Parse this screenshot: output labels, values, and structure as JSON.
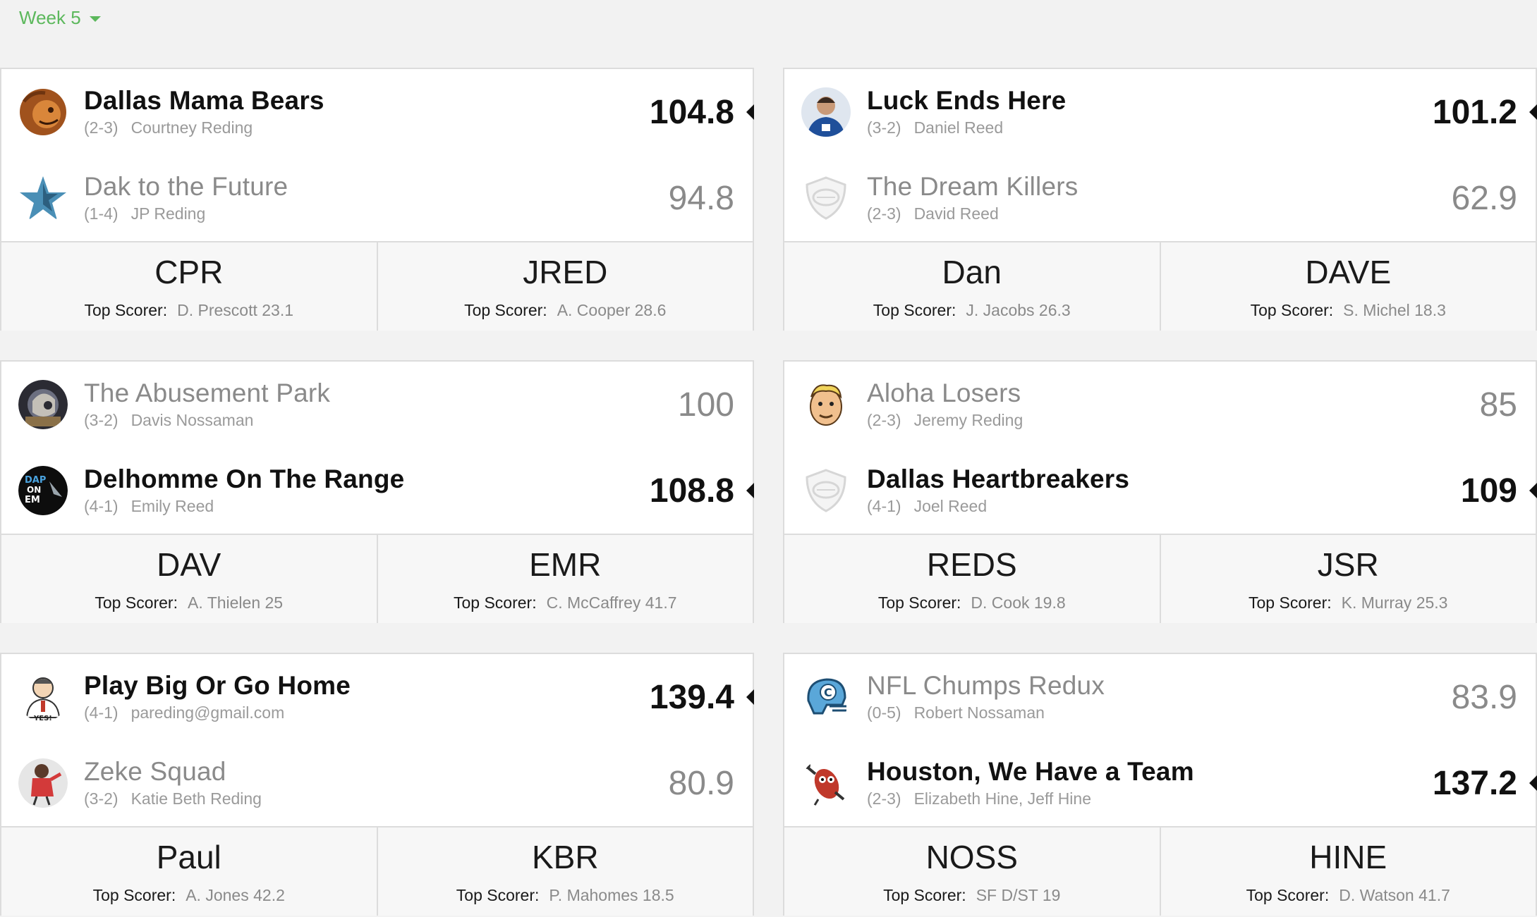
{
  "week_selector": {
    "label": "Week 5"
  },
  "labels": {
    "top_scorer": "Top Scorer:"
  },
  "colors": {
    "accent": "#5cb85c",
    "winner_text": "#111111",
    "loser_text": "#8a8a8a",
    "card_bg": "#ffffff",
    "page_bg": "#f2f2f2"
  },
  "matchups": [
    {
      "home": {
        "name": "Dallas Mama Bears",
        "record": "(2-3)",
        "owner": "Courtney Reding",
        "score": "104.8",
        "icon": "lion-logo-icon",
        "winner": true
      },
      "away": {
        "name": "Dak to the Future",
        "record": "(1-4)",
        "owner": "JP Reding",
        "score": "94.8",
        "icon": "star-logo-icon",
        "winner": false
      },
      "footer": [
        {
          "abbr": "CPR",
          "top_scorer": "D. Prescott 23.1"
        },
        {
          "abbr": "JRED",
          "top_scorer": "A. Cooper 28.6"
        }
      ]
    },
    {
      "home": {
        "name": "Luck Ends Here",
        "record": "(3-2)",
        "owner": "Daniel Reed",
        "score": "101.2",
        "icon": "player-photo-icon",
        "winner": true
      },
      "away": {
        "name": "The Dream Killers",
        "record": "(2-3)",
        "owner": "David Reed",
        "score": "62.9",
        "icon": "default-shield-icon",
        "winner": false
      },
      "footer": [
        {
          "abbr": "Dan",
          "top_scorer": "J. Jacobs 26.3"
        },
        {
          "abbr": "DAVE",
          "top_scorer": "S. Michel 18.3"
        }
      ]
    },
    {
      "home": {
        "name": "The Abusement Park",
        "record": "(3-2)",
        "owner": "Davis Nossaman",
        "score": "100",
        "icon": "photo-avatar-icon",
        "winner": false
      },
      "away": {
        "name": "Delhomme On The Range",
        "record": "(4-1)",
        "owner": "Emily Reed",
        "score": "108.8",
        "icon": "text-logo-icon",
        "winner": true
      },
      "footer": [
        {
          "abbr": "DAV",
          "top_scorer": "A. Thielen 25"
        },
        {
          "abbr": "EMR",
          "top_scorer": "C. McCaffrey 41.7"
        }
      ]
    },
    {
      "home": {
        "name": "Aloha Losers",
        "record": "(2-3)",
        "owner": "Jeremy Reding",
        "score": "85",
        "icon": "cartoon-face-icon",
        "winner": false
      },
      "away": {
        "name": "Dallas Heartbreakers",
        "record": "(4-1)",
        "owner": "Joel Reed",
        "score": "109",
        "icon": "default-shield-icon",
        "winner": true
      },
      "footer": [
        {
          "abbr": "REDS",
          "top_scorer": "D. Cook 19.8"
        },
        {
          "abbr": "JSR",
          "top_scorer": "K. Murray 25.3"
        }
      ]
    },
    {
      "home": {
        "name": "Play Big Or Go Home",
        "record": "(4-1)",
        "owner": "pareding@gmail.com",
        "score": "139.4",
        "icon": "cartoon-man-icon",
        "winner": true
      },
      "away": {
        "name": "Zeke Squad",
        "record": "(3-2)",
        "owner": "Katie Beth Reding",
        "score": "80.9",
        "icon": "red-mascot-icon",
        "winner": false
      },
      "footer": [
        {
          "abbr": "Paul",
          "top_scorer": "A. Jones 42.2"
        },
        {
          "abbr": "KBR",
          "top_scorer": "P. Mahomes 18.5"
        }
      ]
    },
    {
      "home": {
        "name": "NFL Chumps Redux",
        "record": "(0-5)",
        "owner": "Robert Nossaman",
        "score": "83.9",
        "icon": "helmet-icon",
        "winner": false
      },
      "away": {
        "name": "Houston, We Have a Team",
        "record": "(2-3)",
        "owner": "Elizabeth Hine, Jeff Hine",
        "score": "137.2",
        "icon": "football-mascot-icon",
        "winner": true
      },
      "footer": [
        {
          "abbr": "NOSS",
          "top_scorer": "SF D/ST 19"
        },
        {
          "abbr": "HINE",
          "top_scorer": "D. Watson 41.7"
        }
      ]
    }
  ]
}
